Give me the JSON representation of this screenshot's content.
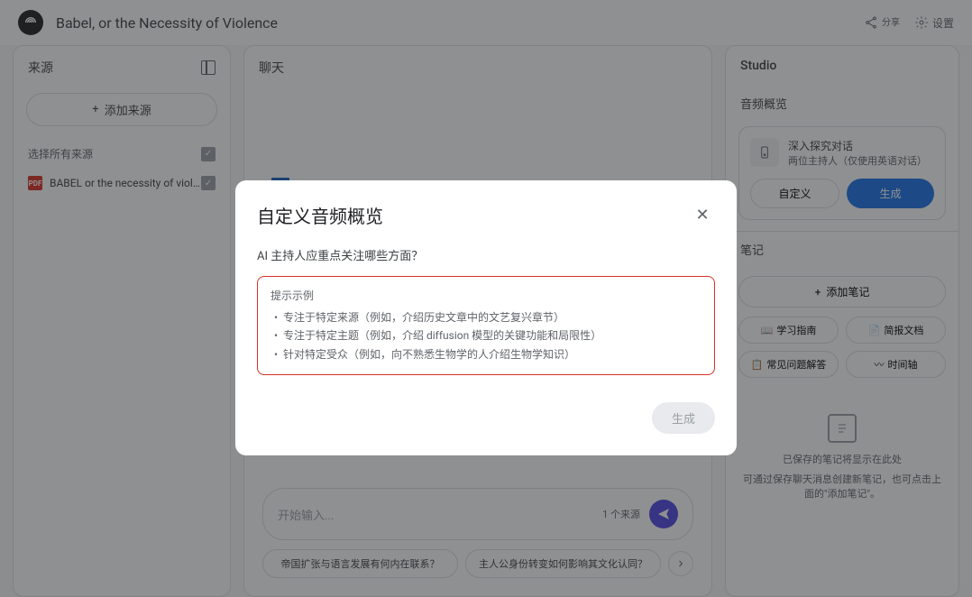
{
  "header": {
    "title": "Babel, or the Necessity of Violence",
    "share": "分享",
    "settings": "设置"
  },
  "sources": {
    "title": "来源",
    "add_button": "添加来源",
    "select_all": "选择所有来源",
    "items": [
      {
        "name": "BABEL or the necessity of viol...",
        "checked": true
      }
    ]
  },
  "chat": {
    "title": "聊天",
    "input_placeholder": "开始输入...",
    "source_count": "1 个来源",
    "suggestions": [
      "帝国扩张与语言发展有何内在联系？",
      "主人公身份转变如何影响其文化认同？"
    ]
  },
  "studio": {
    "title": "Studio",
    "audio_section": "音频概览",
    "audio_card": {
      "title": "深入探究对话",
      "subtitle": "两位主持人（仅使用英语对话）",
      "customize": "自定义",
      "generate": "生成"
    },
    "notes_section": "笔记",
    "add_note": "添加笔记",
    "note_actions": [
      "学习指南",
      "简报文档",
      "常见问题解答",
      "时间轴"
    ],
    "empty_title": "已保存的笔记将显示在此处",
    "empty_desc": "可通过保存聊天消息创建新笔记，也可点击上面的\"添加笔记\"。"
  },
  "modal": {
    "title": "自定义音频概览",
    "question": "AI 主持人应重点关注哪些方面？",
    "prompt_label": "提示示例",
    "examples": [
      "专注于特定来源（例如，介绍历史文章中的文艺复兴章节）",
      "专注于特定主题（例如，介绍 diffusion 模型的关键功能和局限性）",
      "针对特定受众（例如，向不熟悉生物学的人介绍生物学知识）"
    ],
    "generate": "生成"
  }
}
